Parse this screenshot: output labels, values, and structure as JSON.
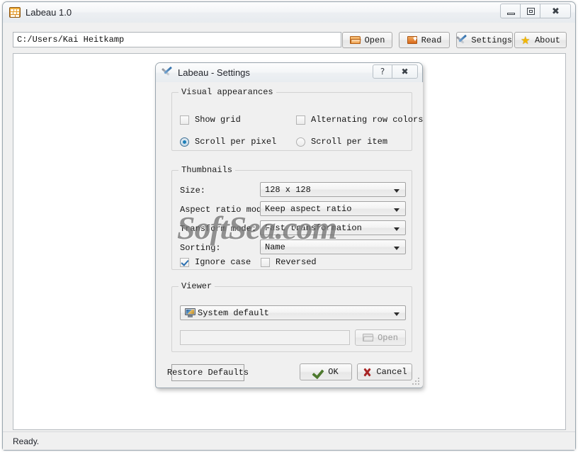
{
  "main_window": {
    "title": "Labeau 1.0",
    "app_icon": "labeau-app-icon",
    "caption": {
      "minimize": "minimize-icon",
      "maximize": "maximize-icon",
      "close": "close-icon"
    },
    "path_field": {
      "value": "C:/Users/Kai Heitkamp",
      "placeholder": ""
    },
    "toolbar": [
      {
        "label": "Open",
        "icon": "open-folder-icon"
      },
      {
        "label": "Read",
        "icon": "read-folder-icon"
      },
      {
        "label": "Settings",
        "icon": "tools-icon"
      },
      {
        "label": "About",
        "icon": "star-icon"
      }
    ],
    "status": "Ready."
  },
  "settings_dialog": {
    "title": "Labeau - Settings",
    "icon": "tools-icon",
    "caption": {
      "help": "?",
      "close": "✖"
    },
    "visual_appearances": {
      "title": "Visual appearances",
      "show_grid": {
        "label": "Show grid",
        "checked": false
      },
      "alternating_row_colors": {
        "label": "Alternating row colors",
        "checked": false
      },
      "scroll_per_pixel": {
        "label": "Scroll per pixel",
        "checked": true
      },
      "scroll_per_item": {
        "label": "Scroll per item",
        "checked": false
      }
    },
    "thumbnails": {
      "title": "Thumbnails",
      "size": {
        "label": "Size:",
        "value": "128 x 128"
      },
      "aspect_ratio_mode": {
        "label": "Aspect ratio mode:",
        "value": "Keep aspect ratio"
      },
      "transform_mode": {
        "label": "Transform mode:",
        "value": "Fast transformation"
      },
      "sorting": {
        "label": "Sorting:",
        "value": "Name"
      },
      "ignore_case": {
        "label": "Ignore case",
        "checked": true
      },
      "reversed": {
        "label": "Reversed",
        "checked": false
      }
    },
    "viewer": {
      "title": "Viewer",
      "selected": {
        "value": "System default",
        "icon": "monitor-icon"
      },
      "path": {
        "value": "",
        "placeholder": ""
      },
      "open_button": {
        "label": "Open",
        "icon": "open-folder-icon",
        "enabled": false
      }
    },
    "buttons": {
      "restore_defaults": "Restore Defaults",
      "ok": "OK",
      "cancel": "Cancel"
    }
  },
  "watermark": {
    "text": "SoftSea.com"
  },
  "colors": {
    "window_bg": "#f0f0f0",
    "accent_blue": "#1d7fb8",
    "ok_green": "#4e7a2f",
    "cancel_red": "#a82626",
    "icon_orange": "#e5862b"
  }
}
